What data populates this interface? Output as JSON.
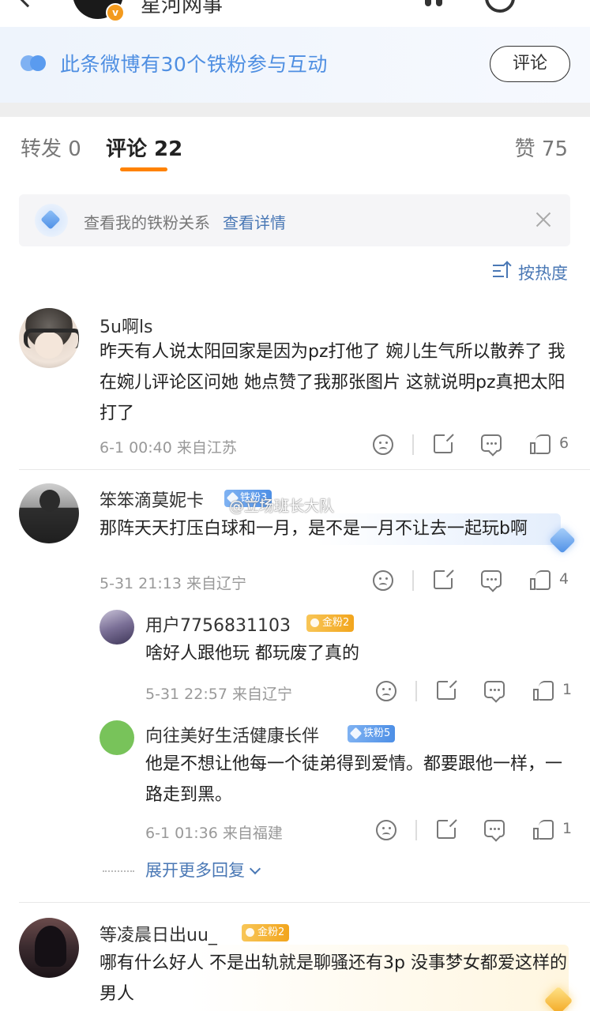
{
  "header": {
    "name": "星河网事",
    "vbadge": "v"
  },
  "fan_banner": {
    "text": "此条微博有30个铁粉参与互动",
    "button": "评论"
  },
  "tabs": {
    "repost": "转发 0",
    "comment": "评论 22",
    "like": "赞 75"
  },
  "notice": {
    "text": "查看我的铁粉关系",
    "link": "查看详情"
  },
  "sort": {
    "label": "按热度"
  },
  "comments": [
    {
      "user": "5u啊ls",
      "text": "昨天有人说太阳回家是因为pz打他了 婉儿生气所以散养了 我在婉儿评论区问她 她点赞了我那张图片 这就说明pz真把太阳打了",
      "meta": "6-1 00:40 来自江苏",
      "likes": "6"
    },
    {
      "user": "笨笨滴莫妮卡",
      "badge": "铁粉3",
      "text": "那阵天天打压白球和一月，是不是一月不让去一起玩b啊",
      "meta": "5-31 21:13 来自辽宁",
      "likes": "4",
      "replies": [
        {
          "user": "用户7756831103",
          "badge": "金粉2",
          "text": "啥好人跟他玩 都玩废了真的",
          "meta": "5-31 22:57 来自辽宁",
          "likes": "1"
        },
        {
          "user": "向往美好生活健康长伴",
          "badge": "铁粉5",
          "text": "他是不想让他每一个徒弟得到爱情。都要跟他一样，一路走到黑。",
          "meta": "6-1 01:36 来自福建",
          "likes": "1"
        }
      ],
      "expand": "展开更多回复"
    },
    {
      "user": "等凌晨日出uu_",
      "badge": "金粉2",
      "text": "哪有什么好人 不是出轨就是聊骚还有3p 没事梦女都爱这样的男人"
    }
  ],
  "watermark": "@立场班长大队",
  "colors": {
    "accent_orange": "#ff8200",
    "link_blue": "#4a78b5",
    "fan_blue": "#4f8fe2"
  }
}
